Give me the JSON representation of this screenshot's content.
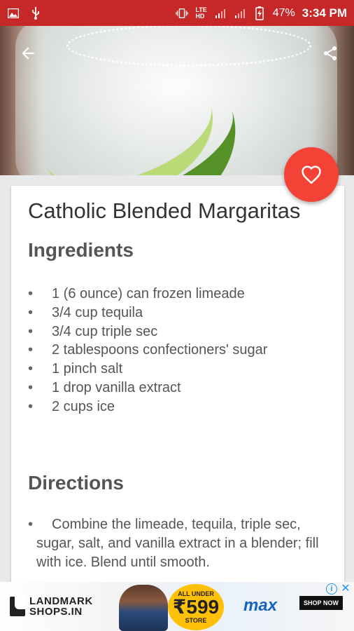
{
  "status_bar": {
    "battery_percent": "47%",
    "time": "3:34 PM",
    "network_labels": [
      "LTE",
      "HD"
    ]
  },
  "recipe": {
    "title": "Catholic Blended Margaritas",
    "ingredients_heading": "Ingredients",
    "ingredients": [
      "1 (6 ounce) can frozen limeade",
      "3/4 cup tequila",
      "3/4 cup triple sec",
      "2 tablespoons confectioners' sugar",
      "1 pinch salt",
      "1 drop vanilla extract",
      "2 cups ice"
    ],
    "directions_heading": "Directions",
    "directions": [
      "Combine the limeade, tequila, triple sec, sugar, salt, and vanilla extract in a blender; fill with ice. Blend until smooth."
    ]
  },
  "ad": {
    "logo_line1": "LANDMARK",
    "logo_line2": "SHOPS.IN",
    "price_top": "ALL UNDER",
    "price": "₹599",
    "price_bottom": "STORE",
    "brand": "max",
    "cta": "SHOP NOW"
  },
  "colors": {
    "status_bar": "#c62828",
    "fab": "#f44336",
    "heading_text": "#555555"
  },
  "icons": {
    "back": "arrow-left-icon",
    "share": "share-icon",
    "favorite": "heart-outline-icon"
  }
}
